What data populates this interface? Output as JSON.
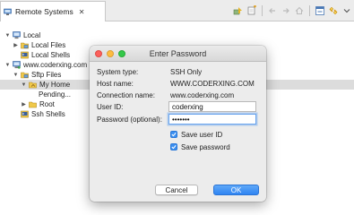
{
  "view": {
    "tab_label": "Remote Systems",
    "tab_close": "✕",
    "toolbar_icons": [
      "connect-icon",
      "new-connection-icon",
      "back-icon",
      "forward-icon",
      "home-icon",
      "collapse-all-icon",
      "link-editor-icon",
      "view-menu-icon"
    ]
  },
  "tree": {
    "items": [
      {
        "label": "Local",
        "expanded": true,
        "icon": "computer-icon"
      },
      {
        "label": "Local Files",
        "expanded": false,
        "icon": "folder-icon"
      },
      {
        "label": "Local Shells",
        "expanded": null,
        "icon": "shell-icon"
      },
      {
        "label": "www.coderxing.com",
        "expanded": true,
        "icon": "remote-server-icon"
      },
      {
        "label": "Sftp Files",
        "expanded": true,
        "icon": "folder-icon"
      },
      {
        "label": "My Home",
        "expanded": true,
        "icon": "home-folder-icon",
        "selected": true
      },
      {
        "label": "Pending...",
        "expanded": null,
        "icon": ""
      },
      {
        "label": "Root",
        "expanded": false,
        "icon": "folder-icon"
      },
      {
        "label": "Ssh Shells",
        "expanded": null,
        "icon": "shell-icon"
      }
    ]
  },
  "dialog": {
    "title": "Enter Password",
    "system_type_label": "System type:",
    "system_type_value": "SSH Only",
    "host_name_label": "Host name:",
    "host_name_value": "WWW.CODERXING.COM",
    "connection_name_label": "Connection name:",
    "connection_name_value": "www.coderxing.com",
    "user_id_label": "User ID:",
    "user_id_value": "coderxing",
    "password_label": "Password (optional):",
    "password_value": "•••••••",
    "save_user_id_label": "Save user ID",
    "save_user_id_checked": true,
    "save_password_label": "Save password",
    "save_password_checked": true,
    "cancel_label": "Cancel",
    "ok_label": "OK"
  },
  "colors": {
    "accent": "#3b8ff0",
    "ok_button": "#2f84f2",
    "selection": "#dcdcdc"
  }
}
